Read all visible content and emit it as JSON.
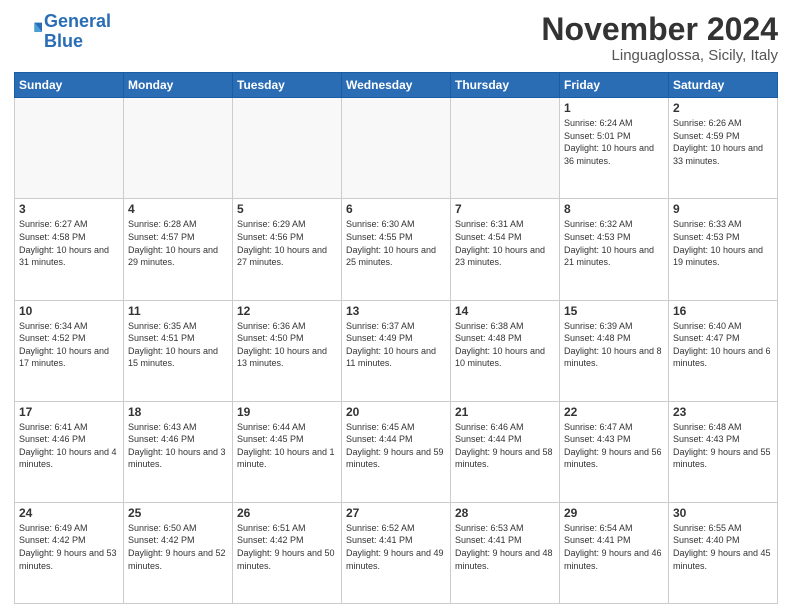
{
  "header": {
    "logo_line1": "General",
    "logo_line2": "Blue",
    "month": "November 2024",
    "location": "Linguaglossa, Sicily, Italy"
  },
  "days_of_week": [
    "Sunday",
    "Monday",
    "Tuesday",
    "Wednesday",
    "Thursday",
    "Friday",
    "Saturday"
  ],
  "weeks": [
    [
      {
        "day": "",
        "info": ""
      },
      {
        "day": "",
        "info": ""
      },
      {
        "day": "",
        "info": ""
      },
      {
        "day": "",
        "info": ""
      },
      {
        "day": "",
        "info": ""
      },
      {
        "day": "1",
        "info": "Sunrise: 6:24 AM\nSunset: 5:01 PM\nDaylight: 10 hours and 36 minutes."
      },
      {
        "day": "2",
        "info": "Sunrise: 6:26 AM\nSunset: 4:59 PM\nDaylight: 10 hours and 33 minutes."
      }
    ],
    [
      {
        "day": "3",
        "info": "Sunrise: 6:27 AM\nSunset: 4:58 PM\nDaylight: 10 hours and 31 minutes."
      },
      {
        "day": "4",
        "info": "Sunrise: 6:28 AM\nSunset: 4:57 PM\nDaylight: 10 hours and 29 minutes."
      },
      {
        "day": "5",
        "info": "Sunrise: 6:29 AM\nSunset: 4:56 PM\nDaylight: 10 hours and 27 minutes."
      },
      {
        "day": "6",
        "info": "Sunrise: 6:30 AM\nSunset: 4:55 PM\nDaylight: 10 hours and 25 minutes."
      },
      {
        "day": "7",
        "info": "Sunrise: 6:31 AM\nSunset: 4:54 PM\nDaylight: 10 hours and 23 minutes."
      },
      {
        "day": "8",
        "info": "Sunrise: 6:32 AM\nSunset: 4:53 PM\nDaylight: 10 hours and 21 minutes."
      },
      {
        "day": "9",
        "info": "Sunrise: 6:33 AM\nSunset: 4:53 PM\nDaylight: 10 hours and 19 minutes."
      }
    ],
    [
      {
        "day": "10",
        "info": "Sunrise: 6:34 AM\nSunset: 4:52 PM\nDaylight: 10 hours and 17 minutes."
      },
      {
        "day": "11",
        "info": "Sunrise: 6:35 AM\nSunset: 4:51 PM\nDaylight: 10 hours and 15 minutes."
      },
      {
        "day": "12",
        "info": "Sunrise: 6:36 AM\nSunset: 4:50 PM\nDaylight: 10 hours and 13 minutes."
      },
      {
        "day": "13",
        "info": "Sunrise: 6:37 AM\nSunset: 4:49 PM\nDaylight: 10 hours and 11 minutes."
      },
      {
        "day": "14",
        "info": "Sunrise: 6:38 AM\nSunset: 4:48 PM\nDaylight: 10 hours and 10 minutes."
      },
      {
        "day": "15",
        "info": "Sunrise: 6:39 AM\nSunset: 4:48 PM\nDaylight: 10 hours and 8 minutes."
      },
      {
        "day": "16",
        "info": "Sunrise: 6:40 AM\nSunset: 4:47 PM\nDaylight: 10 hours and 6 minutes."
      }
    ],
    [
      {
        "day": "17",
        "info": "Sunrise: 6:41 AM\nSunset: 4:46 PM\nDaylight: 10 hours and 4 minutes."
      },
      {
        "day": "18",
        "info": "Sunrise: 6:43 AM\nSunset: 4:46 PM\nDaylight: 10 hours and 3 minutes."
      },
      {
        "day": "19",
        "info": "Sunrise: 6:44 AM\nSunset: 4:45 PM\nDaylight: 10 hours and 1 minute."
      },
      {
        "day": "20",
        "info": "Sunrise: 6:45 AM\nSunset: 4:44 PM\nDaylight: 9 hours and 59 minutes."
      },
      {
        "day": "21",
        "info": "Sunrise: 6:46 AM\nSunset: 4:44 PM\nDaylight: 9 hours and 58 minutes."
      },
      {
        "day": "22",
        "info": "Sunrise: 6:47 AM\nSunset: 4:43 PM\nDaylight: 9 hours and 56 minutes."
      },
      {
        "day": "23",
        "info": "Sunrise: 6:48 AM\nSunset: 4:43 PM\nDaylight: 9 hours and 55 minutes."
      }
    ],
    [
      {
        "day": "24",
        "info": "Sunrise: 6:49 AM\nSunset: 4:42 PM\nDaylight: 9 hours and 53 minutes."
      },
      {
        "day": "25",
        "info": "Sunrise: 6:50 AM\nSunset: 4:42 PM\nDaylight: 9 hours and 52 minutes."
      },
      {
        "day": "26",
        "info": "Sunrise: 6:51 AM\nSunset: 4:42 PM\nDaylight: 9 hours and 50 minutes."
      },
      {
        "day": "27",
        "info": "Sunrise: 6:52 AM\nSunset: 4:41 PM\nDaylight: 9 hours and 49 minutes."
      },
      {
        "day": "28",
        "info": "Sunrise: 6:53 AM\nSunset: 4:41 PM\nDaylight: 9 hours and 48 minutes."
      },
      {
        "day": "29",
        "info": "Sunrise: 6:54 AM\nSunset: 4:41 PM\nDaylight: 9 hours and 46 minutes."
      },
      {
        "day": "30",
        "info": "Sunrise: 6:55 AM\nSunset: 4:40 PM\nDaylight: 9 hours and 45 minutes."
      }
    ]
  ]
}
